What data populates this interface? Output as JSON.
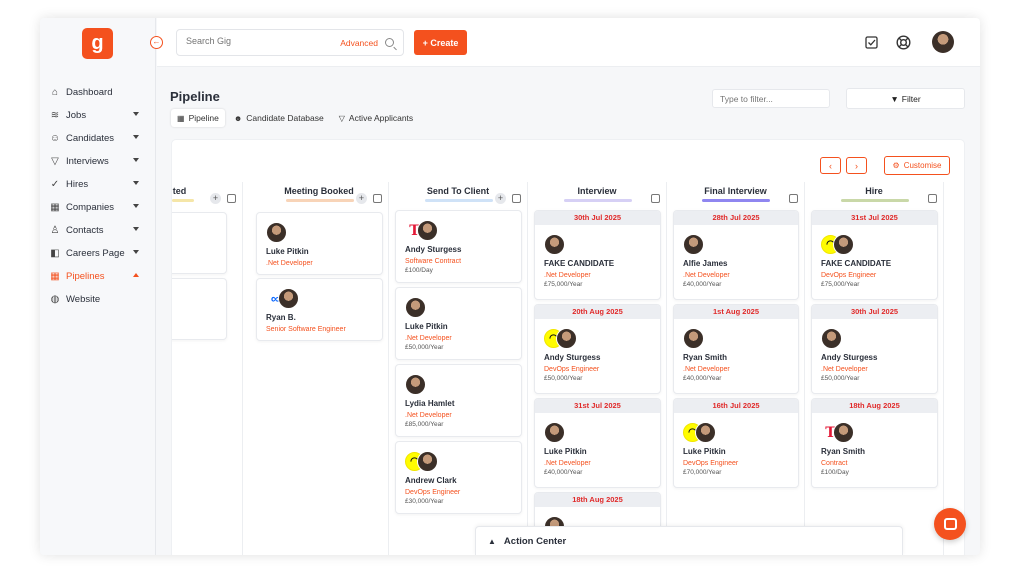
{
  "sidebar": {
    "logo": "g",
    "items": [
      {
        "label": "Dashboard",
        "icon": "home-icon",
        "dropdown": false,
        "active": false
      },
      {
        "label": "Jobs",
        "icon": "layers-icon",
        "dropdown": true,
        "active": false
      },
      {
        "label": "Candidates",
        "icon": "users-icon",
        "dropdown": true,
        "active": false
      },
      {
        "label": "Interviews",
        "icon": "funnel-icon",
        "dropdown": true,
        "active": false
      },
      {
        "label": "Hires",
        "icon": "check-icon",
        "dropdown": true,
        "active": false
      },
      {
        "label": "Companies",
        "icon": "building-icon",
        "dropdown": true,
        "active": false
      },
      {
        "label": "Contacts",
        "icon": "contact-icon",
        "dropdown": true,
        "active": false
      },
      {
        "label": "Careers Page",
        "icon": "careers-icon",
        "dropdown": true,
        "active": false
      },
      {
        "label": "Pipelines",
        "icon": "grid-icon",
        "dropdown": true,
        "active": true
      },
      {
        "label": "Website",
        "icon": "globe-icon",
        "dropdown": false,
        "active": false
      }
    ]
  },
  "topbar": {
    "search_placeholder": "Search Gig",
    "advanced": "Advanced",
    "create": "+ Create"
  },
  "page": {
    "title": "Pipeline",
    "tabs": [
      "Pipeline",
      "Candidate Database",
      "Active Applicants"
    ],
    "filter_placeholder": "Type to filter...",
    "filter_button": "Filter",
    "customise": "Customise"
  },
  "columns": [
    {
      "title": "ted",
      "bar": "#f5e6a8",
      "cards": [
        {
          "date": "",
          "name": "",
          "role": "",
          "salary": "",
          "logo": ""
        },
        {
          "date": "",
          "name": "",
          "role": "",
          "salary": "",
          "logo": ""
        }
      ]
    },
    {
      "title": "Meeting Booked",
      "bar": "#f8d4b8",
      "cards": [
        {
          "date": "",
          "name": "Luke Pitkin",
          "role": ".Net Developer",
          "salary": "",
          "logo": ""
        },
        {
          "date": "",
          "name": "Ryan B.",
          "role": "Senior Software Engineer",
          "salary": "",
          "logo": "meta"
        }
      ]
    },
    {
      "title": "Send To Client",
      "bar": "#cfe2f7",
      "cards": [
        {
          "date": "",
          "name": "Andy Sturgess",
          "role": "Software Contract",
          "salary": "£100/Day",
          "logo": "tesla"
        },
        {
          "date": "",
          "name": "Luke Pitkin",
          "role": ".Net Developer",
          "salary": "£50,000/Year",
          "logo": ""
        },
        {
          "date": "",
          "name": "Lydia Hamlet",
          "role": ".Net Developer",
          "salary": "£85,000/Year",
          "logo": ""
        },
        {
          "date": "",
          "name": "Andrew Clark",
          "role": "DevOps Engineer",
          "salary": "£30,000/Year",
          "logo": "snap"
        }
      ]
    },
    {
      "title": "Interview",
      "bar": "#d6d0f5",
      "cards": [
        {
          "date": "30th Jul 2025",
          "name": "FAKE CANDIDATE",
          "role": ".Net Developer",
          "salary": "£75,000/Year",
          "logo": ""
        },
        {
          "date": "20th Aug 2025",
          "name": "Andy Sturgess",
          "role": "DevOps Engineer",
          "salary": "£50,000/Year",
          "logo": "snap"
        },
        {
          "date": "31st Jul 2025",
          "name": "Luke Pitkin",
          "role": ".Net Developer",
          "salary": "£40,000/Year",
          "logo": ""
        },
        {
          "date": "18th Aug 2025",
          "name": "",
          "role": "",
          "salary": "",
          "logo": ""
        }
      ]
    },
    {
      "title": "Final Interview",
      "bar": "#8f86f0",
      "cards": [
        {
          "date": "28th Jul 2025",
          "name": "Alfie James",
          "role": ".Net Developer",
          "salary": "£40,000/Year",
          "logo": ""
        },
        {
          "date": "1st Aug 2025",
          "name": "Ryan Smith",
          "role": ".Net Developer",
          "salary": "£40,000/Year",
          "logo": ""
        },
        {
          "date": "16th Jul 2025",
          "name": "Luke Pitkin",
          "role": "DevOps Engineer",
          "salary": "£70,000/Year",
          "logo": "snap"
        }
      ]
    },
    {
      "title": "Hire",
      "bar": "#c9d8a8",
      "cards": [
        {
          "date": "31st Jul 2025",
          "name": "FAKE CANDIDATE",
          "role": "DevOps Engineer",
          "salary": "£75,000/Year",
          "logo": "snap"
        },
        {
          "date": "30th Jul 2025",
          "name": "Andy Sturgess",
          "role": ".Net Developer",
          "salary": "£50,000/Year",
          "logo": ""
        },
        {
          "date": "18th Aug 2025",
          "name": "Ryan Smith",
          "role": "Contract",
          "salary": "£100/Day",
          "logo": "tesla"
        }
      ]
    }
  ],
  "action_center": "Action Center",
  "colors": {
    "accent": "#f4511e",
    "date_text": "#e02a2a"
  }
}
